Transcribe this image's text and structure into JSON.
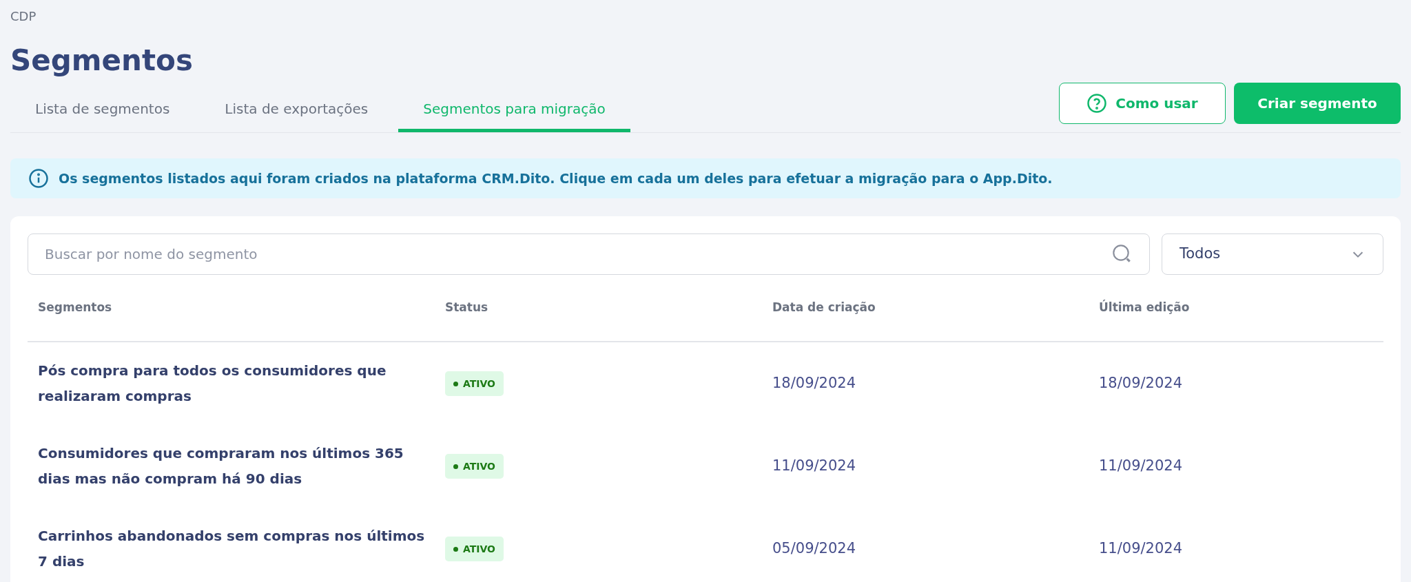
{
  "breadcrumb": "CDP",
  "title": "Segmentos",
  "tabs": [
    {
      "label": "Lista de segmentos",
      "selected": false
    },
    {
      "label": "Lista de exportações",
      "selected": false
    },
    {
      "label": "Segmentos para migração",
      "selected": true
    }
  ],
  "buttons": {
    "help": "Como usar",
    "create": "Criar segmento"
  },
  "info_banner": "Os segmentos listados aqui foram criados na plataforma CRM.Dito. Clique em cada um deles para efetuar a migração para o App.Dito.",
  "search": {
    "placeholder": "Buscar por nome do segmento"
  },
  "filter": {
    "value": "Todos"
  },
  "table": {
    "columns": [
      "Segmentos",
      "Status",
      "Data de criação",
      "Última edição"
    ],
    "rows": [
      {
        "name": "Pós compra para todos os consumidores que realizaram compras",
        "status": "ATIVO",
        "created": "18/09/2024",
        "edited": "18/09/2024"
      },
      {
        "name": "Consumidores que compraram nos últimos 365 dias mas não compram há 90 dias",
        "status": "ATIVO",
        "created": "11/09/2024",
        "edited": "11/09/2024"
      },
      {
        "name": "Carrinhos abandonados sem compras nos últimos 7 dias",
        "status": "ATIVO",
        "created": "05/09/2024",
        "edited": "11/09/2024"
      }
    ]
  }
}
